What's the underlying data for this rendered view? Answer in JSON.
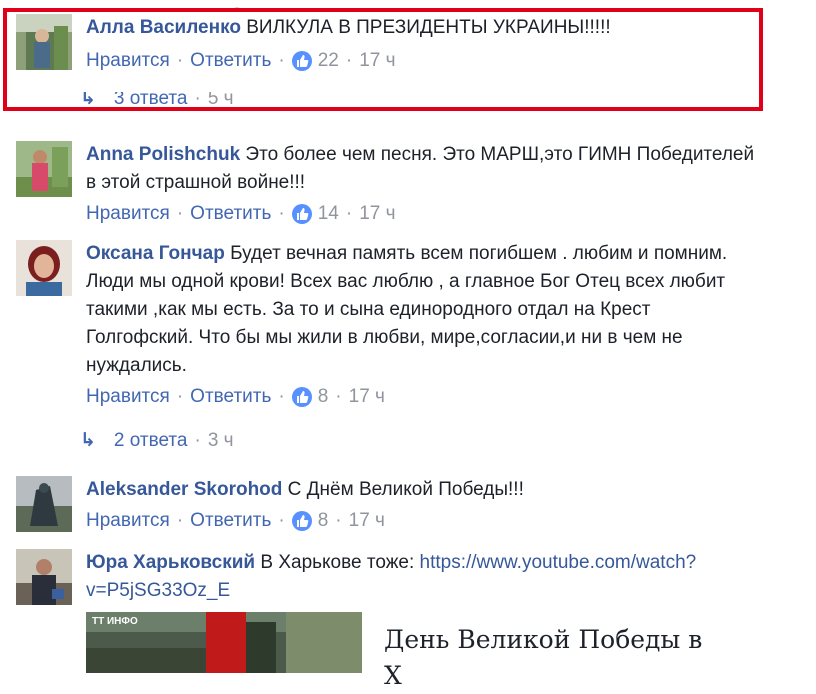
{
  "colors": {
    "author_link": "#365899",
    "action_link": "#4267b2",
    "meta_gray": "#90949c",
    "like_badge": "#5890ff",
    "highlight_border": "#e0001a"
  },
  "actions": {
    "like_label": "Нравится",
    "reply_label": "Ответить",
    "separator": "·"
  },
  "comments": [
    {
      "author": "Алла Василенко",
      "text_lines": [
        "ВИЛКУЛА В ПРЕЗИДЕНТЫ УКРАИНЫ!!!!!"
      ],
      "likes": "22",
      "time": "17 ч",
      "replies": {
        "label": "3 ответа",
        "time": "5 ч"
      }
    },
    {
      "author": "Anna Polishchuk",
      "text_lines": [
        "Это более чем песня. Это МАРШ,это ГИМН Победителей",
        "в этой страшной войне!!!"
      ],
      "likes": "14",
      "time": "17 ч"
    },
    {
      "author": "Оксана Гончар",
      "text_lines": [
        "Будет вечная память всем погибшем . любим и помним.",
        "Люди мы одной крови! Всех вас люблю , а главное Бог Отец всех любит",
        "такими ,как мы есть. За то и сына единородного отдал на Крест",
        "Голгофский. Что бы мы жили в любви, мире,согласии,и ни в чем не",
        "нуждались."
      ],
      "likes": "8",
      "time": "17 ч",
      "replies": {
        "label": "2 ответа",
        "time": "3 ч"
      }
    },
    {
      "author": "Aleksander Skorohod",
      "text_lines": [
        "С Днём Великой Победы!!!"
      ],
      "likes": "8",
      "time": "17 ч"
    },
    {
      "author": "Юра Харьковский",
      "text_prefix": "В Харькове тоже: ",
      "link_line1": "https://www.youtube.com/watch?",
      "link_line2": "v=P5jSG33Oz_E"
    }
  ],
  "preview": {
    "title": "День Великой Победы в",
    "title_line2": "Х",
    "image_badge": "ТТ ИНФО"
  }
}
